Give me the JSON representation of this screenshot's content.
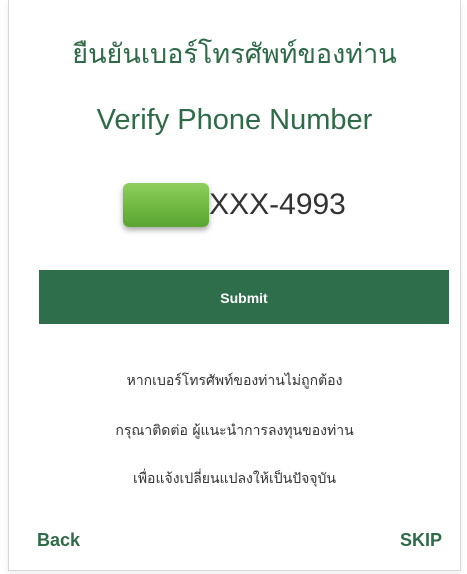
{
  "header": {
    "title_th": "ยืนยันเบอร์โทรศัพท์ของท่าน",
    "title_en": "Verify Phone Number"
  },
  "phone": {
    "masked_number": "XXX-4993"
  },
  "actions": {
    "submit_label": "Submit",
    "back_label": "Back",
    "skip_label": "SKIP"
  },
  "notice": {
    "line1": "หากเบอร์โทรศัพท์ของท่านไม่ถูกต้อง",
    "line2": "กรุณาติดต่อ ผู้แนะนำการลงทุนของท่าน",
    "line3": "เพื่อแจ้งเปลี่ยนแปลงให้เป็นปัจจุบัน"
  },
  "colors": {
    "brand_green": "#2e6e4b",
    "mask_green": "#6eb83f"
  }
}
